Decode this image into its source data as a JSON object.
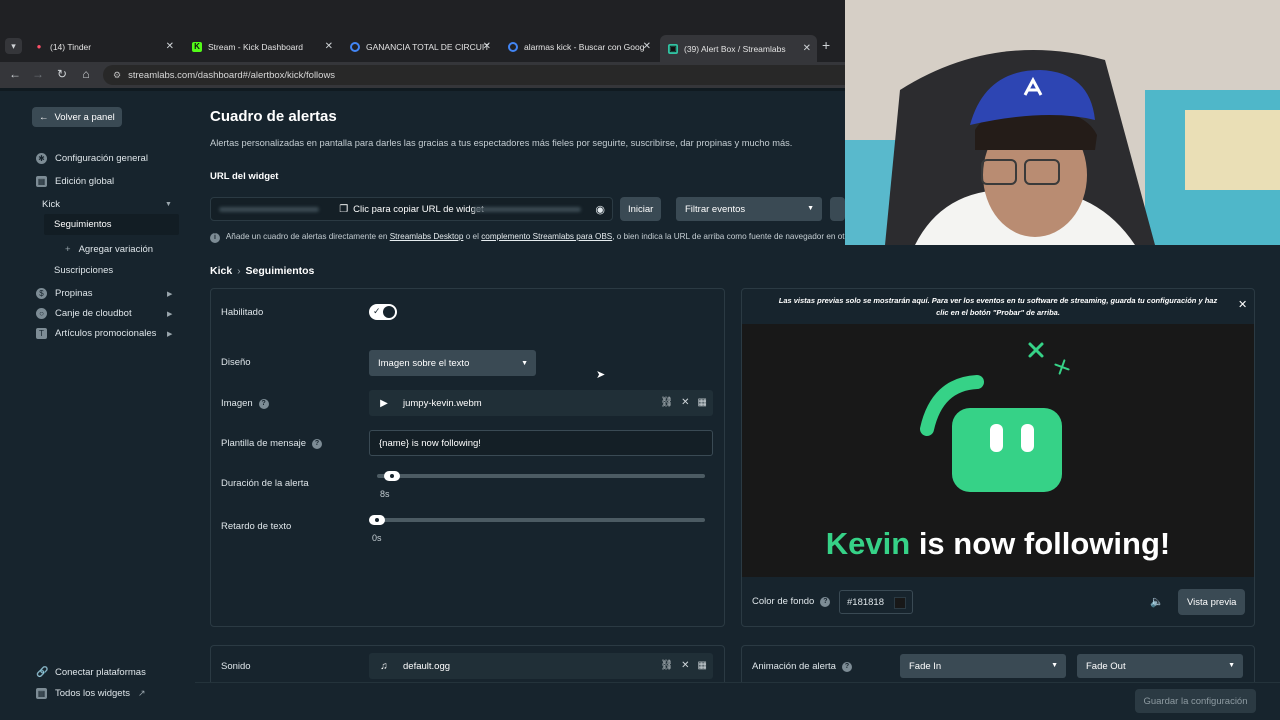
{
  "browser": {
    "tabs": [
      {
        "title": "(14) Tinder",
        "color": "#fd5068"
      },
      {
        "title": "Stream - Kick Dashboard",
        "color": "#53fc18"
      },
      {
        "title": "GANANCIA TOTAL DE CIRCUITO",
        "color": "#4285f4"
      },
      {
        "title": "alarmas kick - Buscar con Goog",
        "color": "#4285f4"
      },
      {
        "title": "(39) Alert Box / Streamlabs",
        "color": "#31c3a2"
      }
    ],
    "url": "streamlabs.com/dashboard#/alertbox/kick/follows"
  },
  "sidebar": {
    "back_label": "Volver a panel",
    "items": [
      {
        "label": "Configuración general"
      },
      {
        "label": "Edición global"
      },
      {
        "label": "Kick"
      },
      {
        "label": "Seguimientos"
      },
      {
        "label": "Agregar variación"
      },
      {
        "label": "Suscripciones"
      },
      {
        "label": "Propinas"
      },
      {
        "label": "Canje de cloudbot"
      },
      {
        "label": "Artículos promocionales"
      }
    ],
    "footer": [
      {
        "label": "Conectar plataformas"
      },
      {
        "label": "Todos los widgets"
      }
    ]
  },
  "main": {
    "title": "Cuadro de alertas",
    "description": "Alertas personalizadas en pantalla para darles las gracias a tus espectadores más fieles por seguirte, suscribirse, dar propinas y mucho más.",
    "widget_url_label": "URL del widget",
    "copy_url_label": "Clic para copiar URL de widget",
    "start_button": "Iniciar",
    "filter_placeholder": "Filtrar eventos",
    "info": {
      "prefix": "Añade un cuadro de alertas directamente en ",
      "link1": "Streamlabs Desktop",
      "mid": " o el ",
      "link2": "complemento Streamlabs para OBS",
      "suffix": ", o bien indica la URL de arriba como fuente de navegador en otro software"
    },
    "breadcrumb": {
      "platform": "Kick",
      "section": "Seguimientos"
    }
  },
  "settings": {
    "enabled_label": "Habilitado",
    "enabled": true,
    "layout_label": "Diseño",
    "layout_value": "Imagen sobre el texto",
    "image_label": "Imagen",
    "image_file": "jumpy-kevin.webm",
    "template_label": "Plantilla de mensaje",
    "template_value": "{name} is now following!",
    "duration_label": "Duración de la alerta",
    "duration_value": "8s",
    "duration_fraction": 0.024,
    "delay_label": "Retardo de texto",
    "delay_value": "0s",
    "delay_fraction": 0.0,
    "sound_label": "Sonido",
    "sound_file": "default.ogg"
  },
  "preview": {
    "note": "Las vistas previas solo se mostrarán aquí. Para ver los eventos en tu software de streaming, guarda tu configuración y haz clic en el botón \"Probar\" de arriba.",
    "name": "Kevin",
    "message": "is now following!",
    "bg_label": "Color de fondo",
    "bg_value": "#181818",
    "preview_button": "Vista previa",
    "animation_label": "Animación de alerta",
    "anim_in": "Fade In",
    "anim_out": "Fade Out",
    "accent": "#36d287"
  },
  "footer": {
    "save_label": "Guardar la configuración"
  }
}
